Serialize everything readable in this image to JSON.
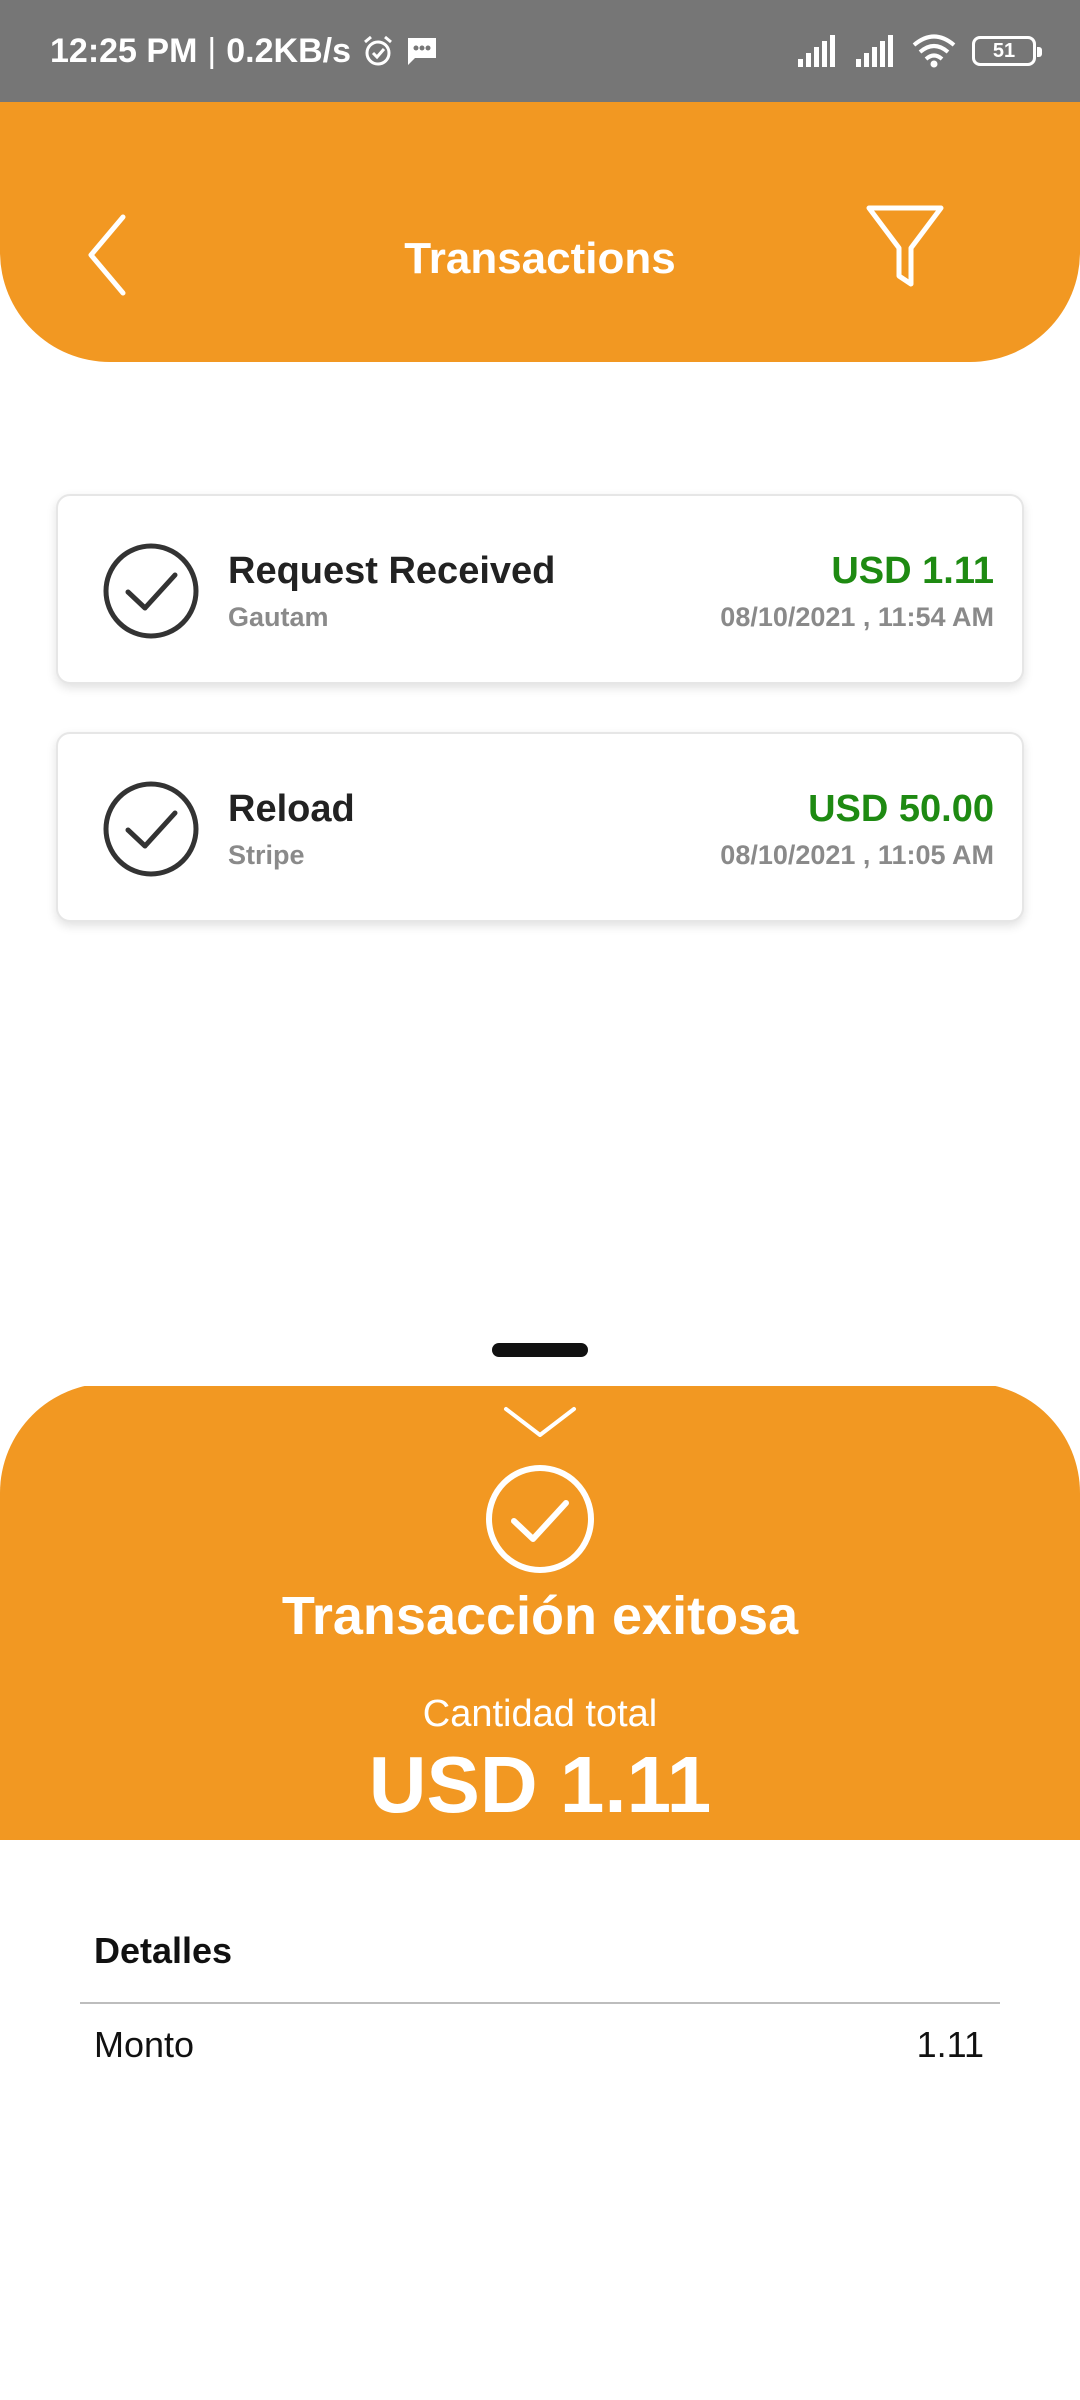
{
  "status_bar": {
    "time": "12:25 PM",
    "separator": "|",
    "network_speed": "0.2KB/s",
    "battery_level": "51",
    "icons": [
      "alarm-icon",
      "message-icon",
      "signal-icon",
      "signal-icon",
      "wifi-icon",
      "battery-icon"
    ]
  },
  "header": {
    "title": "Transactions",
    "back_icon": "chevron-left-icon",
    "filter_icon": "filter-icon"
  },
  "transactions": [
    {
      "title": "Request Received",
      "subtitle": "Gautam",
      "amount": "USD 1.11",
      "datetime": "08/10/2021 , 11:54 AM",
      "icon": "check-circle-icon"
    },
    {
      "title": "Reload",
      "subtitle": "Stripe",
      "amount": "USD 50.00",
      "datetime": "08/10/2021 , 11:05 AM",
      "icon": "check-circle-icon"
    }
  ],
  "sheet": {
    "status": "Transacción exitosa",
    "total_label": "Cantidad total",
    "total_amount": "USD 1.11",
    "details_title": "Detalles",
    "details": [
      {
        "label": "Monto",
        "value": "1.11"
      }
    ]
  },
  "colors": {
    "accent": "#F29822",
    "amount_green": "#1E8A12",
    "status_bar": "#767676"
  }
}
